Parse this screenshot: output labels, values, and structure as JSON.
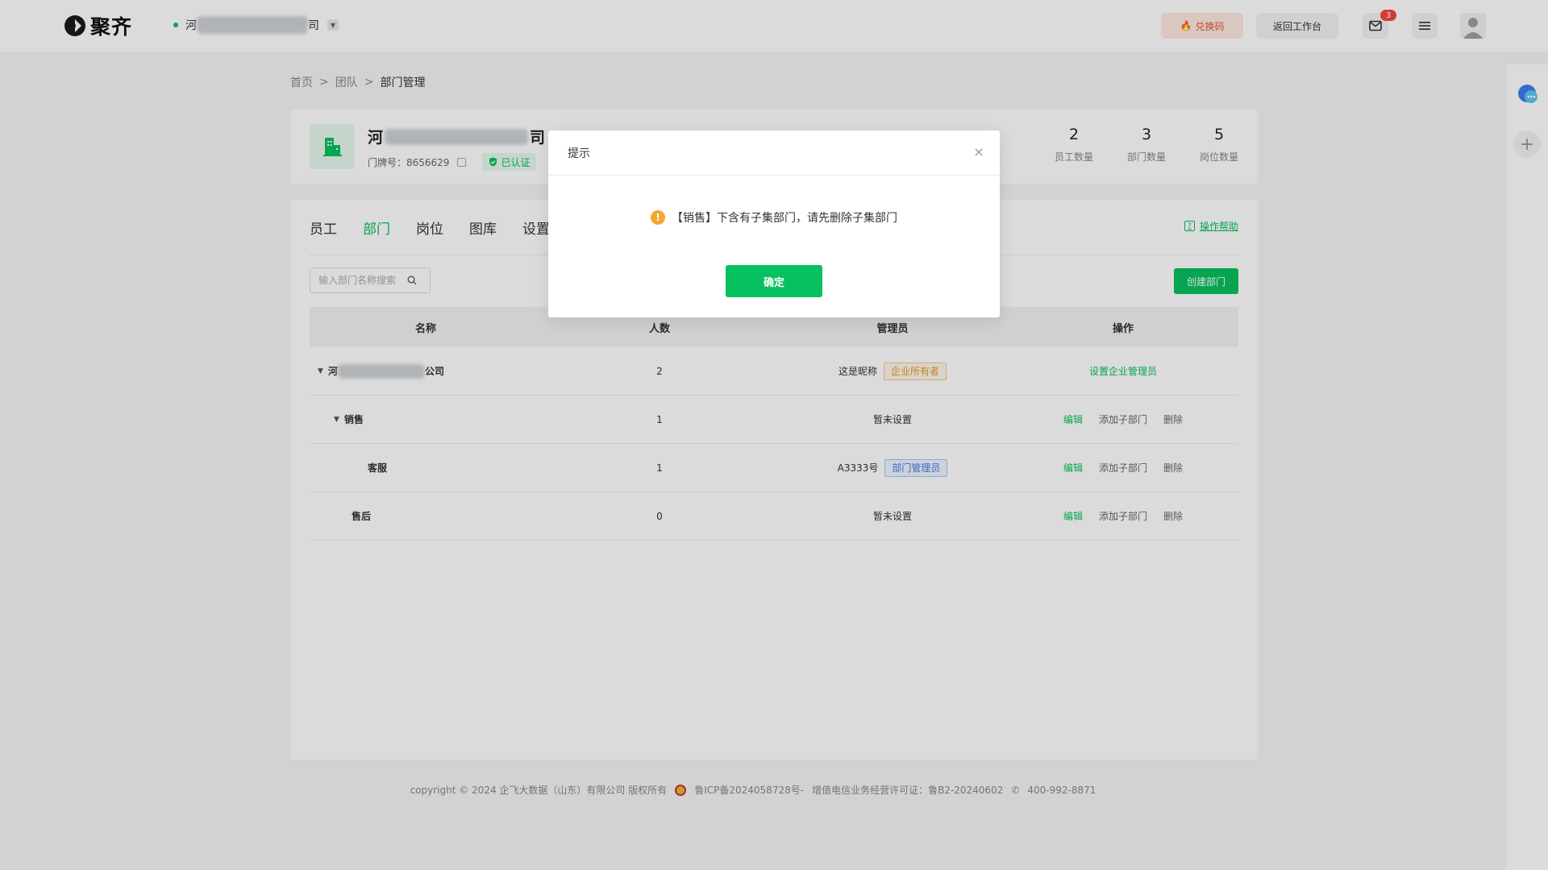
{
  "header": {
    "logo_text": "聚齐",
    "company_prefix": "河",
    "company_suffix": "司",
    "redeem_label": "兑换码",
    "workbench_label": "返回工作台",
    "mail_badge": "3"
  },
  "breadcrumb": {
    "home": "首页",
    "team": "团队",
    "current": "部门管理",
    "separator": ">"
  },
  "company": {
    "name_prefix": "河",
    "name_suffix": "司",
    "door_label": "门牌号：8656629",
    "verified_label": "已认证",
    "stats": [
      {
        "value": "2",
        "label": "员工数量"
      },
      {
        "value": "3",
        "label": "部门数量"
      },
      {
        "value": "5",
        "label": "岗位数量"
      }
    ]
  },
  "tabs": [
    {
      "label": "员工",
      "active": false
    },
    {
      "label": "部门",
      "active": true
    },
    {
      "label": "岗位",
      "active": false
    },
    {
      "label": "图库",
      "active": false
    },
    {
      "label": "设置",
      "active": false
    }
  ],
  "help_label": "操作帮助",
  "search": {
    "placeholder": "输入部门名称搜索"
  },
  "create_label": "创建部门",
  "table": {
    "headers": {
      "name": "名称",
      "count": "人数",
      "admin": "管理员",
      "ops": "操作"
    },
    "rows": [
      {
        "name_prefix": "河",
        "name_suffix": "公司",
        "count": "2",
        "admin": "这是昵称",
        "tag": "企业所有者",
        "op1": "设置企业管理员"
      },
      {
        "name": "销售",
        "count": "1",
        "admin": "暂未设置",
        "op_edit": "编辑",
        "op_add": "添加子部门",
        "op_del": "删除"
      },
      {
        "name": "客服",
        "count": "1",
        "admin": "A3333号",
        "tag": "部门管理员",
        "op_edit": "编辑",
        "op_add": "添加子部门",
        "op_del": "删除"
      },
      {
        "name": "售后",
        "count": "0",
        "admin": "暂未设置",
        "op_edit": "编辑",
        "op_add": "添加子部门",
        "op_del": "删除"
      }
    ]
  },
  "footer": {
    "copyright": "copyright © 2024 企飞大数据（山东）有限公司 版权所有",
    "icp": "鲁ICP备2024058728号-",
    "license": "增值电信业务经营许可证：鲁B2-20240602",
    "phone": "400-992-8871"
  },
  "modal": {
    "title": "提示",
    "message": "【销售】下含有子集部门，请先删除子集部门",
    "ok_label": "确定"
  },
  "colors": {
    "accent": "#07c160",
    "warning": "#f7a531"
  }
}
